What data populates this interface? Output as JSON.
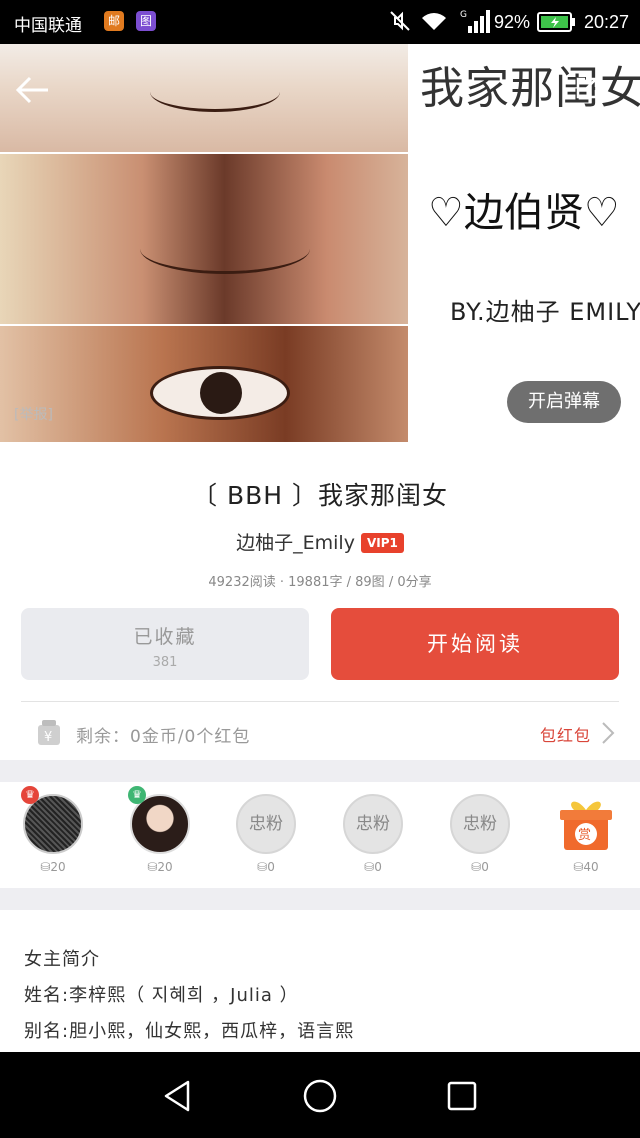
{
  "status_bar": {
    "carrier": "中国联通",
    "app_icon_1": "邮",
    "app_icon_2": "图",
    "battery_pct": "92%",
    "time": "20:27"
  },
  "cover": {
    "title_text": "我家那闺女",
    "heart_name": "♡边伯贤♡",
    "byline": "BY.边柚子 EMILY",
    "report": "[举报]",
    "danmaku_button": "开启弹幕"
  },
  "book": {
    "title": "〔 BBH 〕我家那闺女",
    "author": "边柚子_Emily",
    "vip_badge": "VIP1",
    "stats": "49232阅读 · 19881字 / 89图 / 0分享"
  },
  "actions": {
    "favorite_label": "已收藏",
    "favorite_count": "381",
    "read_label": "开始阅读"
  },
  "balance": {
    "text": "剩余：0金币/0个红包",
    "redpacket_label": "包红包"
  },
  "fans": [
    {
      "type": "grid",
      "value": "20",
      "crown": "red"
    },
    {
      "type": "photo",
      "value": "20",
      "crown": "green"
    },
    {
      "type": "loyal",
      "label": "忠粉",
      "value": "0"
    },
    {
      "type": "loyal",
      "label": "忠粉",
      "value": "0"
    },
    {
      "type": "loyal",
      "label": "忠粉",
      "value": "0"
    },
    {
      "type": "gift",
      "label": "赏",
      "value": "40"
    }
  ],
  "intro": {
    "heading": "女主简介",
    "name_line": "姓名:李梓熙（ 지혜희 ，Julia ）",
    "alias_line": "别名:胆小熙，仙女熙，西瓜梓，语言熙"
  },
  "colors": {
    "accent_red": "#e54d3c",
    "vip_red": "#e8412c",
    "gray_button": "#eaebef"
  }
}
